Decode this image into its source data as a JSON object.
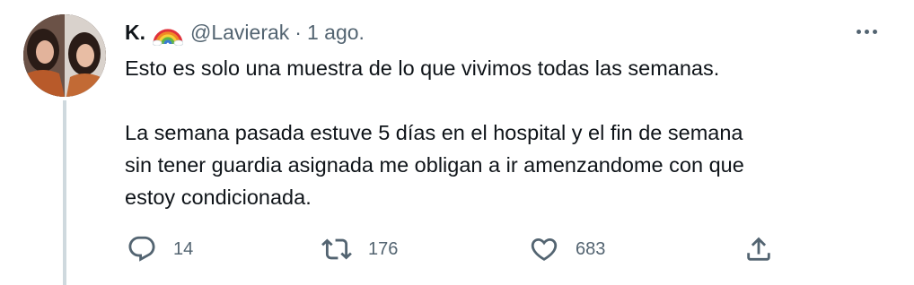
{
  "tweet": {
    "display_name": "K.",
    "handle": "@Lavierak",
    "separator": "·",
    "time": "1 ago.",
    "paragraph1": "Esto es solo una muestra de lo que vivimos todas las semanas.",
    "paragraph2": "La semana pasada estuve 5 días en el hospital y el fin de semana\nsin tener guardia asignada me obligan a ir amenzandome con que\nestoy condicionada.",
    "replies": "14",
    "retweets": "176",
    "likes": "683"
  },
  "icons": {
    "badge": "rainbow-emoji",
    "more": "more-horizontal-icon",
    "reply": "reply-icon",
    "retweet": "retweet-icon",
    "like": "heart-icon",
    "share": "share-icon"
  },
  "colors": {
    "text": "#0f1419",
    "secondary": "#536471",
    "thread_line": "#cfd9de"
  }
}
